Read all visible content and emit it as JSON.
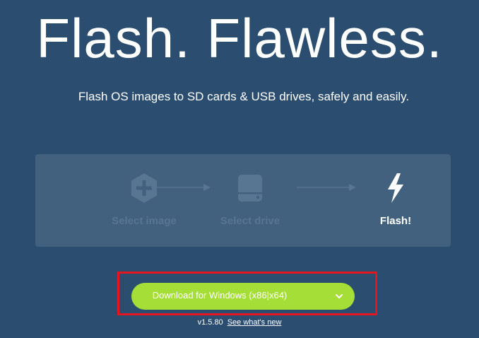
{
  "hero": {
    "title": "Flash. Flawless.",
    "subtitle": "Flash OS images to SD cards & USB drives, safely and easily."
  },
  "steps": [
    {
      "label": "Select image",
      "icon": "plus-hexagon-icon",
      "state": "inactive"
    },
    {
      "label": "Select drive",
      "icon": "drive-icon",
      "state": "inactive"
    },
    {
      "label": "Flash!",
      "icon": "lightning-bolt-icon",
      "state": "active"
    }
  ],
  "download": {
    "label": "Download for Windows (x86|x64)",
    "icon": "chevron-down-icon"
  },
  "footer": {
    "version": "v1.5.80",
    "link_label": "See what's new"
  },
  "colors": {
    "background": "#2b4e70",
    "panel": "#42617f",
    "inactive": "#587592",
    "accent": "#a5de37",
    "highlight": "#e3161f"
  }
}
